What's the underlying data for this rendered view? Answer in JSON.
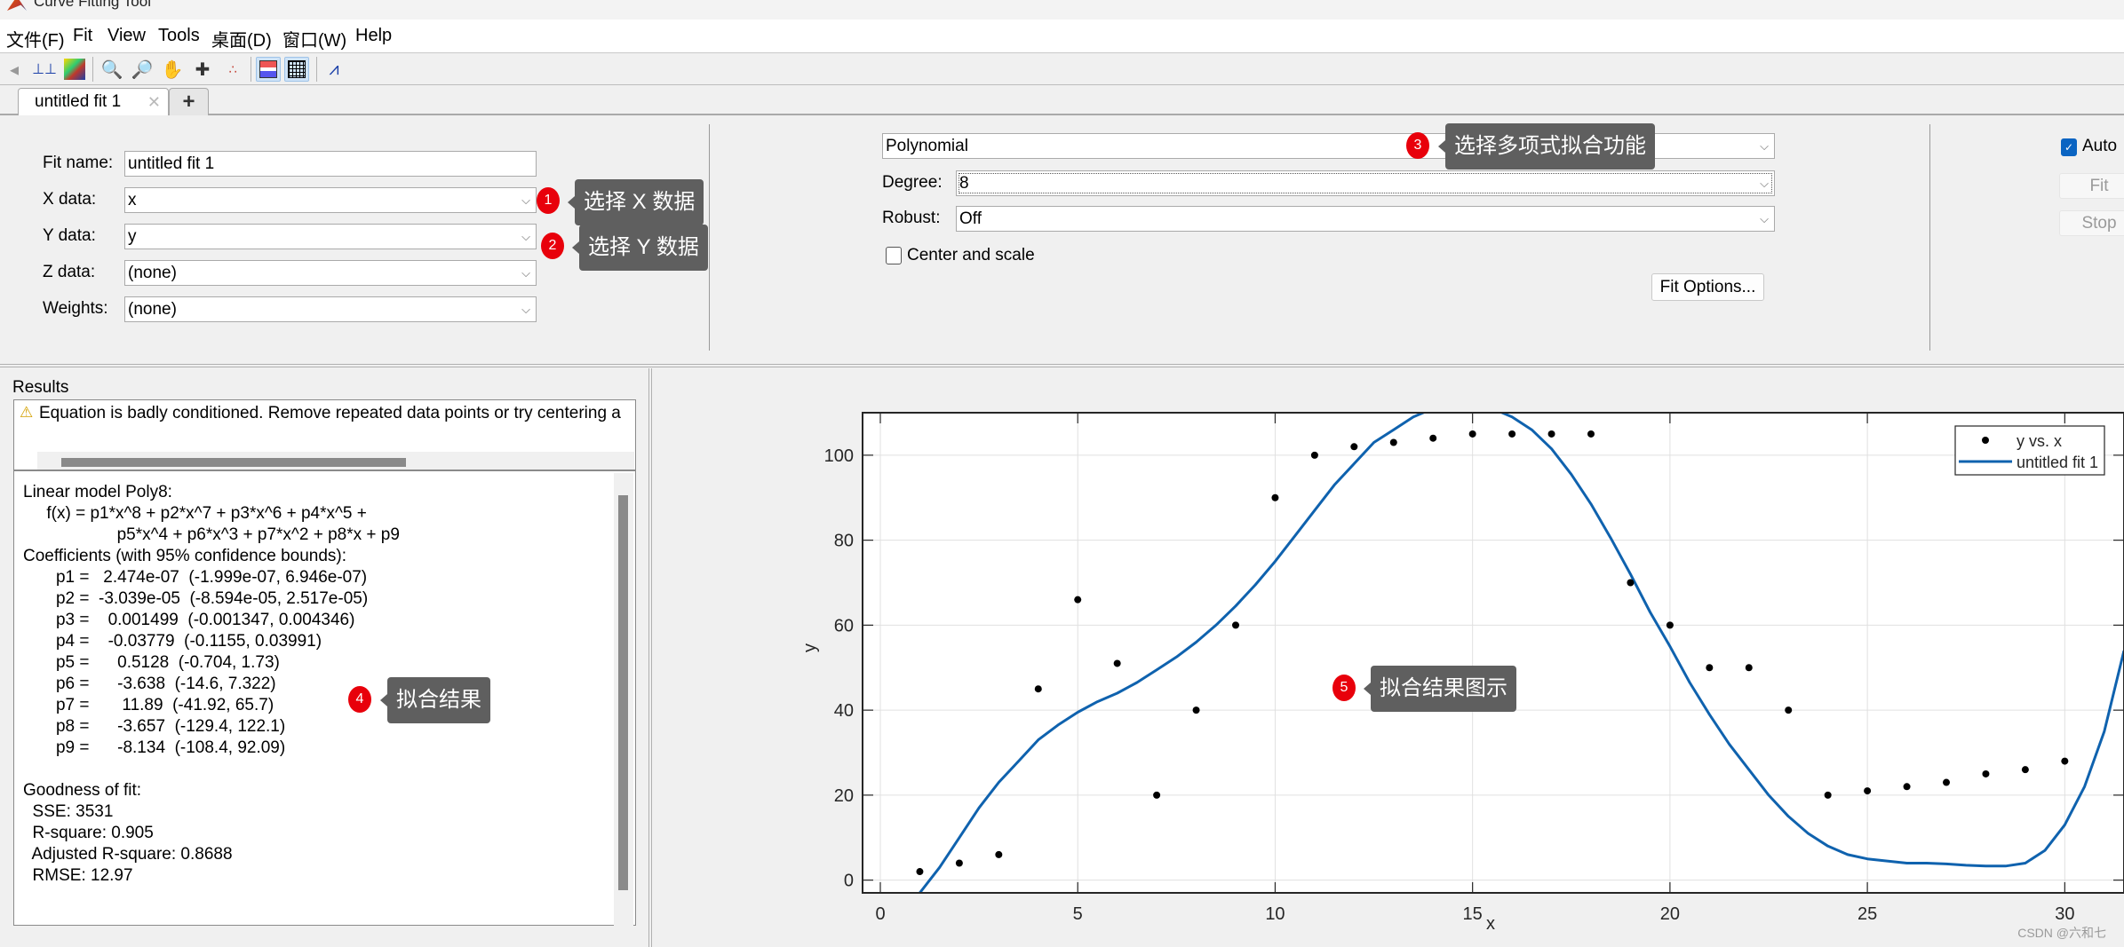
{
  "window": {
    "title": "Curve Fitting Tool"
  },
  "menu": [
    "文件(F)",
    "Fit",
    "View",
    "Tools",
    "桌面(D)",
    "窗口(W)",
    "Help"
  ],
  "toolbar": {
    "icons": [
      "prev-icon",
      "data-cursor-icon",
      "colormap-icon",
      "zoom-in-icon",
      "zoom-out-icon",
      "pan-icon",
      "data-cursor-add-icon",
      "exclude-outliers-icon",
      "legend-toggle-icon",
      "grid-toggle-icon",
      "axes-limits-icon"
    ]
  },
  "tabs": [
    {
      "label": "untitled fit 1",
      "close": "✕"
    }
  ],
  "tab_add": "+",
  "data_panel": {
    "fit_name": {
      "label": "Fit name:",
      "value": "untitled fit 1"
    },
    "x_data": {
      "label": "X data:",
      "value": "x"
    },
    "y_data": {
      "label": "Y data:",
      "value": "y"
    },
    "z_data": {
      "label": "Z data:",
      "value": "(none)"
    },
    "weights": {
      "label": "Weights:",
      "value": "(none)"
    }
  },
  "fit_panel": {
    "fit_type": "Polynomial",
    "degree": {
      "label": "Degree:",
      "value": "8"
    },
    "robust": {
      "label": "Robust:",
      "value": "Off"
    },
    "center_scale": {
      "label": "Center and scale",
      "checked": false
    },
    "fit_options": "Fit Options..."
  },
  "action_panel": {
    "auto": {
      "label": "Auto",
      "checked": true
    },
    "fit": "Fit",
    "stop": "Stop"
  },
  "results": {
    "title": "Results",
    "warning": "Equation is badly conditioned. Remove repeated data points or try centering and scaling.",
    "warning_visible": "Equation is badly conditioned. Remove repeated data points or try centering a",
    "body": "Linear model Poly8:\n     f(x) = p1*x^8 + p2*x^7 + p3*x^6 + p4*x^5 + \n                    p5*x^4 + p6*x^3 + p7*x^2 + p8*x + p9\nCoefficients (with 95% confidence bounds):\n       p1 =   2.474e-07  (-1.999e-07, 6.946e-07)\n       p2 =  -3.039e-05  (-8.594e-05, 2.517e-05)\n       p3 =    0.001499  (-0.001347, 0.004346)\n       p4 =    -0.03779  (-0.1155, 0.03991)\n       p5 =      0.5128  (-0.704, 1.73)\n       p6 =      -3.638  (-14.6, 7.322)\n       p7 =       11.89  (-41.92, 65.7)\n       p8 =      -3.657  (-129.4, 122.1)\n       p9 =      -8.134  (-108.4, 92.09)\n\nGoodness of fit:\n  SSE: 3531\n  R-square: 0.905\n  Adjusted R-square: 0.8688\n  RMSE: 12.97"
  },
  "annotations": [
    {
      "num": "1",
      "text": "选择 X 数据"
    },
    {
      "num": "2",
      "text": "选择 Y 数据"
    },
    {
      "num": "3",
      "text": "选择多项式拟合功能"
    },
    {
      "num": "4",
      "text": "拟合结果"
    },
    {
      "num": "5",
      "text": "拟合结果图示"
    }
  ],
  "watermark": "CSDN @六和七",
  "colors": {
    "fit_line": "#0f62ae",
    "points": "#000000",
    "annotation_dot": "#e8000b",
    "annotation_box": "#5f5f5f"
  },
  "chart_data": {
    "type": "scatter",
    "title": "",
    "xlabel": "x",
    "ylabel": "y",
    "xlim": [
      -0.45,
      31.5
    ],
    "ylim": [
      -3,
      110
    ],
    "xticks": [
      0,
      5,
      10,
      15,
      20,
      25,
      30
    ],
    "yticks": [
      0,
      20,
      40,
      60,
      80,
      100
    ],
    "grid": true,
    "legend": {
      "placement": "top-right",
      "entries": [
        "y vs. x",
        "untitled fit 1"
      ]
    },
    "series": [
      {
        "name": "y vs. x",
        "kind": "points",
        "x": [
          1,
          2,
          3,
          4,
          5,
          6,
          7,
          8,
          9,
          10,
          11,
          12,
          13,
          14,
          15,
          16,
          17,
          18,
          19,
          20,
          21,
          22,
          23,
          24,
          25,
          26,
          27,
          28,
          29,
          30
        ],
        "y": [
          2,
          4,
          6,
          45,
          66,
          51,
          20,
          40,
          60,
          90,
          100,
          102,
          103,
          104,
          105,
          105,
          105,
          105,
          70,
          60,
          50,
          50,
          40,
          20,
          21,
          22,
          23,
          25,
          26,
          28
        ]
      },
      {
        "name": "untitled fit 1",
        "kind": "line",
        "coefficients": [
          2.474e-07,
          -3.039e-05,
          0.001499,
          -0.03779,
          0.5128,
          -3.638,
          11.89,
          -3.657,
          -8.134
        ],
        "x": [
          1.0,
          1.5,
          2,
          2.5,
          3,
          3.5,
          4,
          4.5,
          5,
          5.5,
          6,
          6.5,
          7,
          7.5,
          8,
          8.5,
          9,
          9.5,
          10,
          10.5,
          11,
          11.5,
          12,
          12.5,
          13,
          13.5,
          14,
          14.5,
          15,
          15.5,
          16,
          16.5,
          17,
          17.5,
          18,
          18.5,
          19,
          19.5,
          20,
          20.5,
          21,
          21.5,
          22,
          22.5,
          23,
          23.5,
          24,
          24.5,
          25,
          25.5,
          26,
          26.5,
          27,
          27.5,
          28,
          28.5,
          29,
          29.5,
          30,
          30.5,
          31,
          31.5
        ],
        "y": [
          -3,
          3,
          10,
          17,
          23,
          28,
          33,
          36.5,
          39.5,
          42,
          44,
          46.5,
          49.5,
          52.5,
          56,
          60,
          64.5,
          69.5,
          75,
          81,
          87,
          93,
          98,
          103,
          106,
          109,
          111,
          112,
          112,
          111,
          109,
          106,
          101.5,
          95.5,
          88.5,
          80.5,
          72,
          63,
          55,
          46.5,
          39,
          32,
          26,
          20,
          15,
          11,
          8,
          6,
          5,
          4.5,
          4,
          4,
          3.8,
          3.5,
          3.3,
          3.3,
          4,
          7,
          13,
          22,
          35,
          54
        ]
      }
    ]
  }
}
